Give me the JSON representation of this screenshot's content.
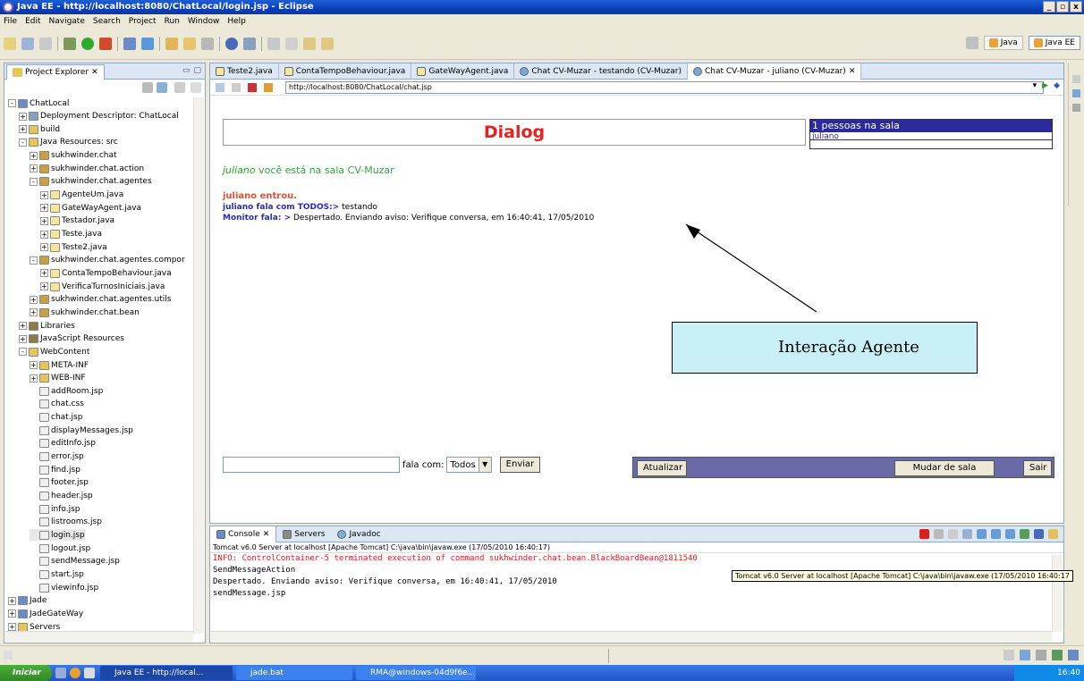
{
  "window": {
    "title": "Java EE - http://localhost:8080/ChatLocal/login.jsp - Eclipse",
    "controls": [
      "_",
      "̅",
      "x"
    ]
  },
  "menu": [
    "File",
    "Edit",
    "Navigate",
    "Search",
    "Project",
    "Run",
    "Window",
    "Help"
  ],
  "perspectives": [
    {
      "label": "Java",
      "active": false
    },
    {
      "label": "Java EE",
      "active": true
    }
  ],
  "project_explorer": {
    "tab": "Project Explorer",
    "tree": [
      {
        "label": "ChatLocal",
        "icon": "project-icon"
      },
      {
        "label": "Deployment Descriptor: ChatLocal",
        "icon": "descriptor-icon"
      },
      {
        "label": "build",
        "icon": "folder-icon"
      },
      {
        "label": "Java Resources: src",
        "icon": "src-folder-icon"
      },
      {
        "label": "sukhwinder.chat",
        "icon": "package-icon"
      },
      {
        "label": "sukhwinder.chat.action",
        "icon": "package-icon"
      },
      {
        "label": "sukhwinder.chat.agentes",
        "icon": "package-icon"
      },
      {
        "label": "AgenteUm.java",
        "icon": "java-file-icon"
      },
      {
        "label": "GateWayAgent.java",
        "icon": "java-file-icon"
      },
      {
        "label": "Testador.java",
        "icon": "java-file-icon"
      },
      {
        "label": "Teste.java",
        "icon": "java-file-icon"
      },
      {
        "label": "Teste2.java",
        "icon": "java-file-icon"
      },
      {
        "label": "sukhwinder.chat.agentes.compor",
        "icon": "package-icon"
      },
      {
        "label": "ContaTempoBehaviour.java",
        "icon": "java-file-icon"
      },
      {
        "label": "VerificaTurnosIniciais.java",
        "icon": "java-file-icon"
      },
      {
        "label": "sukhwinder.chat.agentes.utils",
        "icon": "package-icon"
      },
      {
        "label": "sukhwinder.chat.bean",
        "icon": "package-icon"
      },
      {
        "label": "Libraries",
        "icon": "library-icon"
      },
      {
        "label": "JavaScript Resources",
        "icon": "library-icon"
      },
      {
        "label": "WebContent",
        "icon": "folder-icon"
      },
      {
        "label": "META-INF",
        "icon": "folder-icon"
      },
      {
        "label": "WEB-INF",
        "icon": "folder-icon"
      },
      {
        "label": "addRoom.jsp",
        "icon": "jsp-file-icon"
      },
      {
        "label": "chat.css",
        "icon": "css-file-icon"
      },
      {
        "label": "chat.jsp",
        "icon": "jsp-file-icon"
      },
      {
        "label": "displayMessages.jsp",
        "icon": "jsp-file-icon"
      },
      {
        "label": "editInfo.jsp",
        "icon": "jsp-file-icon"
      },
      {
        "label": "error.jsp",
        "icon": "jsp-file-icon"
      },
      {
        "label": "find.jsp",
        "icon": "jsp-file-icon"
      },
      {
        "label": "footer.jsp",
        "icon": "jsp-file-icon"
      },
      {
        "label": "header.jsp",
        "icon": "jsp-file-icon"
      },
      {
        "label": "info.jsp",
        "icon": "jsp-file-icon"
      },
      {
        "label": "listrooms.jsp",
        "icon": "jsp-file-icon"
      },
      {
        "label": "login.jsp",
        "icon": "jsp-file-icon"
      },
      {
        "label": "logout.jsp",
        "icon": "jsp-file-icon"
      },
      {
        "label": "sendMessage.jsp",
        "icon": "jsp-file-icon"
      },
      {
        "label": "start.jsp",
        "icon": "jsp-file-icon"
      },
      {
        "label": "viewinfo.jsp",
        "icon": "jsp-file-icon"
      },
      {
        "label": "Jade",
        "icon": "project-icon"
      },
      {
        "label": "JadeGateWay",
        "icon": "project-icon"
      },
      {
        "label": "Servers",
        "icon": "folder-icon"
      }
    ]
  },
  "editor": {
    "tabs": [
      {
        "label": "Teste2.java",
        "active": false
      },
      {
        "label": "ContaTempoBehaviour.java",
        "active": false
      },
      {
        "label": "GateWayAgent.java",
        "active": false
      },
      {
        "label": "Chat CV-Muzar - testando (CV-Muzar)",
        "active": false
      },
      {
        "label": "Chat CV-Muzar - juliano (CV-Muzar)",
        "active": true
      }
    ],
    "url": "http://localhost:8080/ChatLocal/chat.jsp"
  },
  "chat": {
    "dialog_title": "Dialog",
    "rooms_header": "1 pessoas na sala",
    "room_user": "juliano",
    "welcome_user": "juliano",
    "welcome_text": "você está na sala CV-Muzar",
    "messages": {
      "enter": "juliano entrou.",
      "line1_prefix": "juliano fala com TODOS:>",
      "line1_text": "testando",
      "line2_prefix": "Monitor fala: >",
      "line2_text": "Despertado. Enviando aviso: Verifique conversa, em 16:40:41, 17/05/2010"
    },
    "annotation": "Interação Agente",
    "fala_com_label": "fala com:",
    "recipient": "Todos",
    "send_button": "Enviar",
    "refresh_button": "Atualizar",
    "change_room_button": "Mudar de sala",
    "exit_button": "Sair"
  },
  "console": {
    "tabs": [
      {
        "label": "Console",
        "active": true
      },
      {
        "label": "Servers",
        "active": false
      },
      {
        "label": "Javadoc",
        "active": false
      }
    ],
    "process": "Tomcat v6.0 Server at localhost [Apache Tomcat] C:\\java\\bin\\javaw.exe (17/05/2010 16:40:17)",
    "lines": [
      "INFO: ControlContainer-5 terminated execution of command sukhwinder.chat.bean.BlackBoardBean@1811540",
      "SendMessageAction",
      "Despertado. Enviando aviso: Verifique conversa, em 16:40:41, 17/05/2010",
      "sendMessage.jsp"
    ],
    "tooltip": "Tomcat v6.0 Server at localhost [Apache Tomcat] C:\\java\\bin\\javaw.exe (17/05/2010 16:40:17"
  },
  "taskbar": {
    "start": "Iniciar",
    "tasks": [
      {
        "label": "Java EE - http://local...",
        "active": true
      },
      {
        "label": "jade.bat",
        "active": false
      },
      {
        "label": "RMA@windows-04d9f6e...",
        "active": false
      }
    ],
    "clock": "16:40"
  },
  "colors": {
    "dialog_title": "#e82020",
    "welcome": "#3aa04a",
    "enter_message": "#e6502a",
    "speaker": "#2a2ac8",
    "annotation_bg": "#c9f0f6",
    "console_error": "#e02020"
  }
}
